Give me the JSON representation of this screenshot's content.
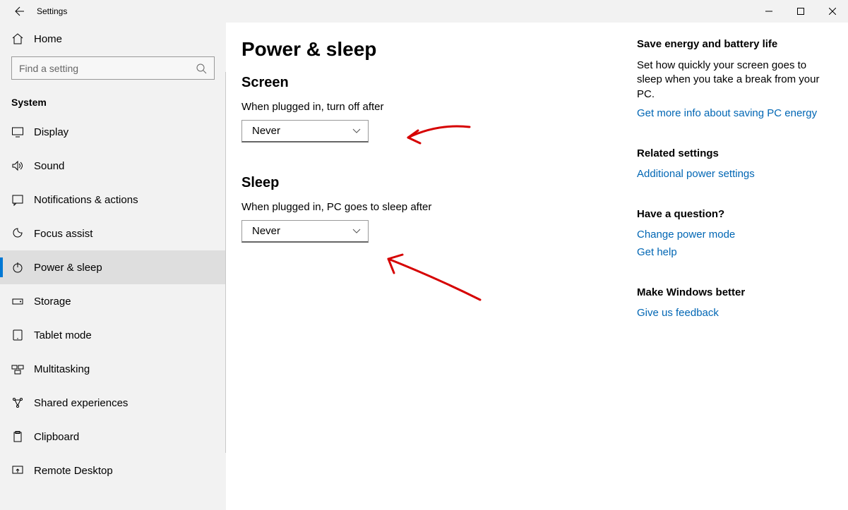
{
  "window": {
    "title": "Settings"
  },
  "sidebar": {
    "home_label": "Home",
    "search_placeholder": "Find a setting",
    "section_label": "System",
    "items": [
      {
        "label": "Display"
      },
      {
        "label": "Sound"
      },
      {
        "label": "Notifications & actions"
      },
      {
        "label": "Focus assist"
      },
      {
        "label": "Power & sleep"
      },
      {
        "label": "Storage"
      },
      {
        "label": "Tablet mode"
      },
      {
        "label": "Multitasking"
      },
      {
        "label": "Shared experiences"
      },
      {
        "label": "Clipboard"
      },
      {
        "label": "Remote Desktop"
      }
    ],
    "selected_index": 4
  },
  "main": {
    "page_title": "Power & sleep",
    "screen_heading": "Screen",
    "screen_label": "When plugged in, turn off after",
    "screen_value": "Never",
    "sleep_heading": "Sleep",
    "sleep_label": "When plugged in, PC goes to sleep after",
    "sleep_value": "Never"
  },
  "aside": {
    "energy_heading": "Save energy and battery life",
    "energy_text": "Set how quickly your screen goes to sleep when you take a break from your PC.",
    "energy_link": "Get more info about saving PC energy",
    "related_heading": "Related settings",
    "related_link": "Additional power settings",
    "question_heading": "Have a question?",
    "question_link_1": "Change power mode",
    "question_link_2": "Get help",
    "feedback_heading": "Make Windows better",
    "feedback_link": "Give us feedback"
  }
}
